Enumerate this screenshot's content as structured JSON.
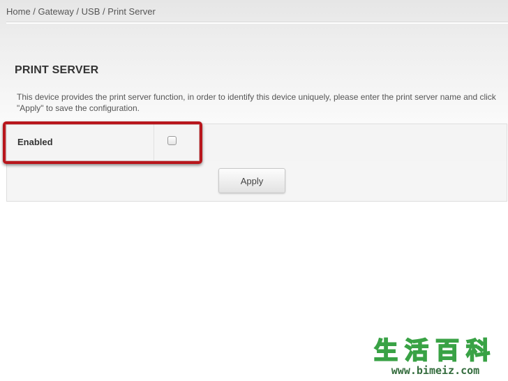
{
  "breadcrumb": "Home / Gateway / USB / Print Server",
  "page": {
    "title": "PRINT SERVER",
    "description": "This device provides the print server function, in order to identify this device uniquely, please enter the print server name and click \"Apply\" to save the configuration."
  },
  "form": {
    "enabled_label": "Enabled",
    "enabled_checked": false,
    "apply_label": "Apply"
  },
  "annotation": {
    "highlight_color": "#b8161c"
  },
  "watermark": {
    "characters": "生活百科",
    "url": "www.bimeiz.com"
  }
}
